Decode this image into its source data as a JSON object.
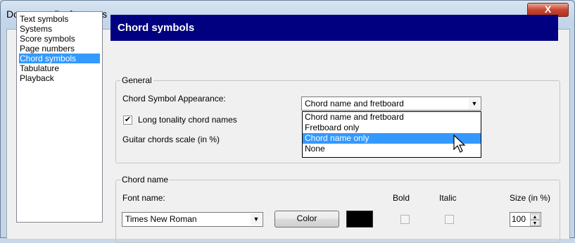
{
  "window": {
    "title": "Document Preferences",
    "close_label": "X"
  },
  "nav": {
    "items": [
      {
        "label": "Text symbols"
      },
      {
        "label": "Systems"
      },
      {
        "label": "Score symbols"
      },
      {
        "label": "Page numbers"
      },
      {
        "label": "Chord symbols",
        "selected": true
      },
      {
        "label": "Tabulature"
      },
      {
        "label": "Playback"
      }
    ]
  },
  "page": {
    "header": "Chord symbols"
  },
  "general": {
    "group_label": "General",
    "appearance_label": "Chord Symbol Appearance:",
    "appearance_value": "Chord name and fretboard",
    "appearance_options": [
      "Chord name and fretboard",
      "Fretboard only",
      "Chord name only",
      "None"
    ],
    "highlighted_option": "Chord name only",
    "long_tonality_label": "Long tonality chord names",
    "long_tonality_checked": true,
    "scale_label": "Guitar chords scale (in %)"
  },
  "chord_name": {
    "group_label": "Chord name",
    "font_label": "Font name:",
    "font_value": "Times New Roman",
    "color_button": "Color",
    "color_value": "#000000",
    "bold_label": "Bold",
    "bold_checked": false,
    "italic_label": "Italic",
    "italic_checked": false,
    "size_label": "Size (in %)",
    "size_value": "100"
  }
}
